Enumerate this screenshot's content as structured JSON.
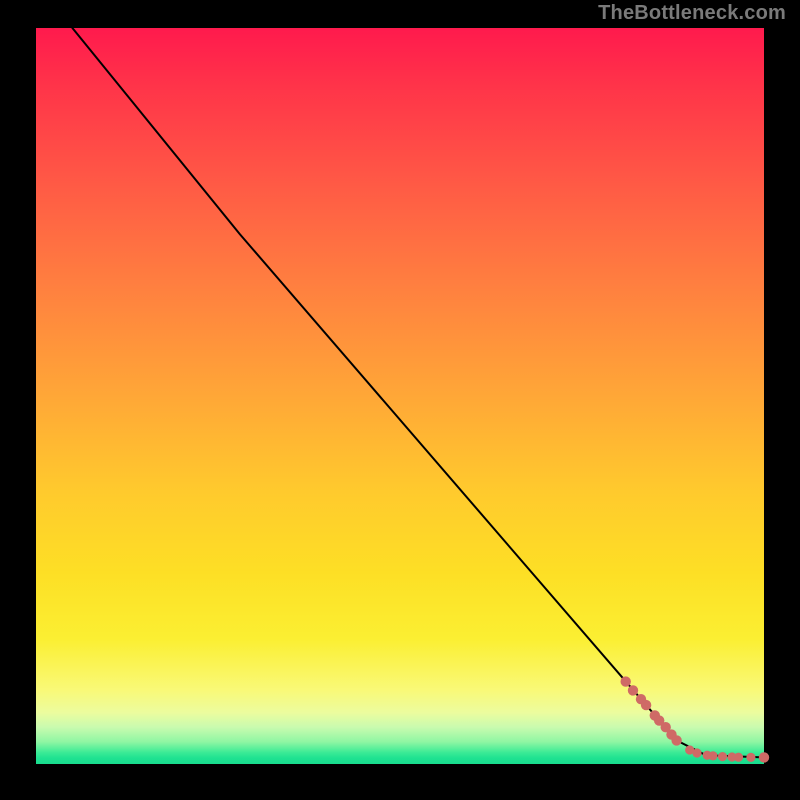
{
  "attribution": "TheBottleneck.com",
  "colors": {
    "marker": "#cf6a66",
    "curve": "#000000"
  },
  "chart_data": {
    "type": "line",
    "title": "",
    "xlabel": "",
    "ylabel": "",
    "xlim": [
      0,
      100
    ],
    "ylim": [
      0,
      100
    ],
    "grid": false,
    "series": [
      {
        "name": "curve",
        "x": [
          5,
          28,
          88,
          92,
          100
        ],
        "y": [
          100,
          72,
          3.2,
          1.2,
          0.9
        ]
      }
    ],
    "markers": {
      "name": "near-bottom-points",
      "points": [
        {
          "x": 81.0,
          "y": 11.2,
          "r": 4.5
        },
        {
          "x": 82.0,
          "y": 10.0,
          "r": 4.5
        },
        {
          "x": 83.1,
          "y": 8.8,
          "r": 4.5
        },
        {
          "x": 83.8,
          "y": 8.0,
          "r": 4.5
        },
        {
          "x": 85.0,
          "y": 6.6,
          "r": 4.5
        },
        {
          "x": 85.6,
          "y": 5.9,
          "r": 4.5
        },
        {
          "x": 86.5,
          "y": 5.0,
          "r": 4.5
        },
        {
          "x": 87.3,
          "y": 4.0,
          "r": 4.5
        },
        {
          "x": 88.0,
          "y": 3.2,
          "r": 4.5
        },
        {
          "x": 89.8,
          "y": 1.9,
          "r": 4.0
        },
        {
          "x": 90.8,
          "y": 1.5,
          "r": 4.0
        },
        {
          "x": 92.2,
          "y": 1.2,
          "r": 4.0
        },
        {
          "x": 93.0,
          "y": 1.1,
          "r": 4.0
        },
        {
          "x": 94.3,
          "y": 1.0,
          "r": 4.0
        },
        {
          "x": 95.6,
          "y": 0.95,
          "r": 4.0
        },
        {
          "x": 96.5,
          "y": 0.93,
          "r": 4.0
        },
        {
          "x": 98.2,
          "y": 0.9,
          "r": 4.0
        },
        {
          "x": 100.0,
          "y": 0.9,
          "r": 4.5
        }
      ]
    }
  }
}
